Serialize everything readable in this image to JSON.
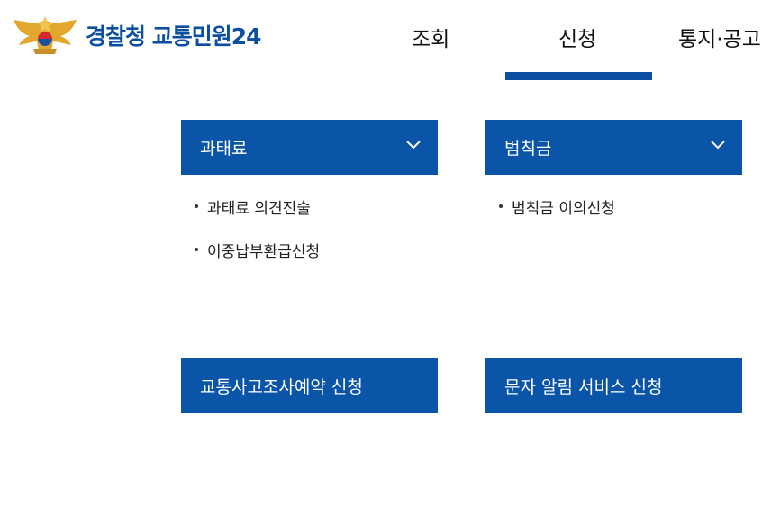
{
  "header": {
    "brand": "경찰청 교통민원24",
    "nav": [
      {
        "label": "조회"
      },
      {
        "label": "신청"
      },
      {
        "label": "통지·공고"
      }
    ]
  },
  "panels": [
    {
      "title": "과태료",
      "items": [
        "과태료 의견진술",
        "이중납부환급신청"
      ]
    },
    {
      "title": "범칙금",
      "items": [
        "범칙금 이의신청"
      ]
    },
    {
      "title": "교통사고조사예약 신청"
    },
    {
      "title": "문자 알림 서비스 신청"
    }
  ],
  "colors": {
    "accent": "#0b55a8",
    "brand": "#0b4fa3"
  }
}
